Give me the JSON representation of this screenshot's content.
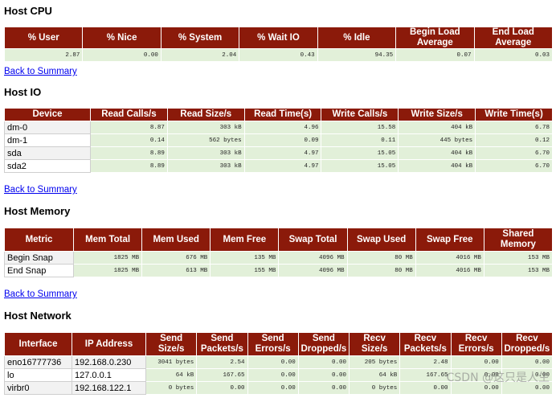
{
  "cpu": {
    "title": "Host CPU",
    "headers": [
      "% User",
      "% Nice",
      "% System",
      "% Wait IO",
      "% Idle",
      "Begin Load Average",
      "End Load Average"
    ],
    "rows": [
      [
        "2.87",
        "0.00",
        "2.04",
        "0.43",
        "94.35",
        "0.07",
        "0.03"
      ]
    ]
  },
  "back_link": "Back to Summary",
  "io": {
    "title": "Host IO",
    "headers": [
      "Device",
      "Read Calls/s",
      "Read Size/s",
      "Read Time(s)",
      "Write Calls/s",
      "Write Size/s",
      "Write Time(s)"
    ],
    "rows": [
      [
        "dm-0",
        "8.87",
        "303 kB",
        "4.96",
        "15.58",
        "404 kB",
        "6.78"
      ],
      [
        "dm-1",
        "0.14",
        "562 bytes",
        "0.09",
        "0.11",
        "445 bytes",
        "0.12"
      ],
      [
        "sda",
        "8.89",
        "303 kB",
        "4.97",
        "15.05",
        "404 kB",
        "6.70"
      ],
      [
        "sda2",
        "8.89",
        "303 kB",
        "4.97",
        "15.05",
        "404 kB",
        "6.70"
      ]
    ]
  },
  "memory": {
    "title": "Host Memory",
    "headers": [
      "Metric",
      "Mem Total",
      "Mem Used",
      "Mem Free",
      "Swap Total",
      "Swap Used",
      "Swap Free",
      "Shared Memory"
    ],
    "rows": [
      [
        "Begin Snap",
        "1825 MB",
        "676 MB",
        "135 MB",
        "4096 MB",
        "80 MB",
        "4016 MB",
        "153 MB"
      ],
      [
        "End Snap",
        "1825 MB",
        "613 MB",
        "155 MB",
        "4096 MB",
        "80 MB",
        "4016 MB",
        "153 MB"
      ]
    ]
  },
  "network": {
    "title": "Host Network",
    "headers": [
      "Interface",
      "IP Address",
      "Send Size/s",
      "Send Packets/s",
      "Send Errors/s",
      "Send Dropped/s",
      "Recv Size/s",
      "Recv Packets/s",
      "Recv Errors/s",
      "Recv Dropped/s"
    ],
    "rows": [
      [
        "eno16777736",
        "192.168.0.230",
        "3041 bytes",
        "2.54",
        "0.00",
        "0.00",
        "205 bytes",
        "2.48",
        "0.00",
        "0.00"
      ],
      [
        "lo",
        "127.0.0.1",
        "64 kB",
        "167.65",
        "0.00",
        "0.00",
        "64 kB",
        "167.65",
        "0.00",
        "0.00"
      ],
      [
        "virbr0",
        "192.168.122.1",
        "0 bytes",
        "0.00",
        "0.00",
        "0.00",
        "0 bytes",
        "0.00",
        "0.00",
        "0.00"
      ]
    ]
  },
  "watermark": "CSDN @这只是人生",
  "colors": {
    "header_bg": "#8b1a0a",
    "cell_bg": "#e2f0d9",
    "link": "#0000ee"
  }
}
